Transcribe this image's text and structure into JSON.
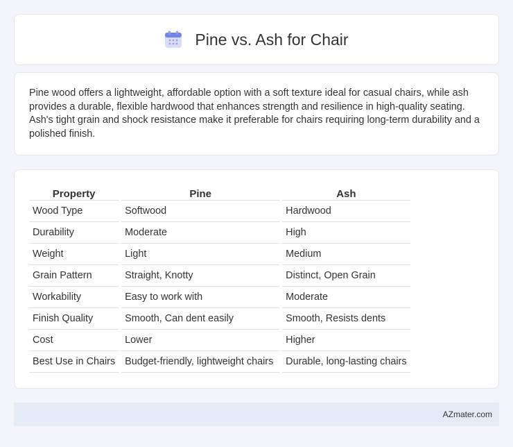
{
  "header": {
    "title": "Pine vs. Ash for Chair",
    "icon": "calendar-icon"
  },
  "description": "Pine wood offers a lightweight, affordable option with a soft texture ideal for casual chairs, while ash provides a durable, flexible hardwood that enhances strength and resilience in high-quality seating. Ash's tight grain and shock resistance make it preferable for chairs requiring long-term durability and a polished finish.",
  "table": {
    "headers": [
      "Property",
      "Pine",
      "Ash"
    ],
    "rows": [
      [
        "Wood Type",
        "Softwood",
        "Hardwood"
      ],
      [
        "Durability",
        "Moderate",
        "High"
      ],
      [
        "Weight",
        "Light",
        "Medium"
      ],
      [
        "Grain Pattern",
        "Straight, Knotty",
        "Distinct, Open Grain"
      ],
      [
        "Workability",
        "Easy to work with",
        "Moderate"
      ],
      [
        "Finish Quality",
        "Smooth, Can dent easily",
        "Smooth, Resists dents"
      ],
      [
        "Cost",
        "Lower",
        "Higher"
      ],
      [
        "Best Use in Chairs",
        "Budget-friendly, lightweight chairs",
        "Durable, long-lasting chairs"
      ]
    ]
  },
  "footer": {
    "text": "AZmater.com"
  }
}
